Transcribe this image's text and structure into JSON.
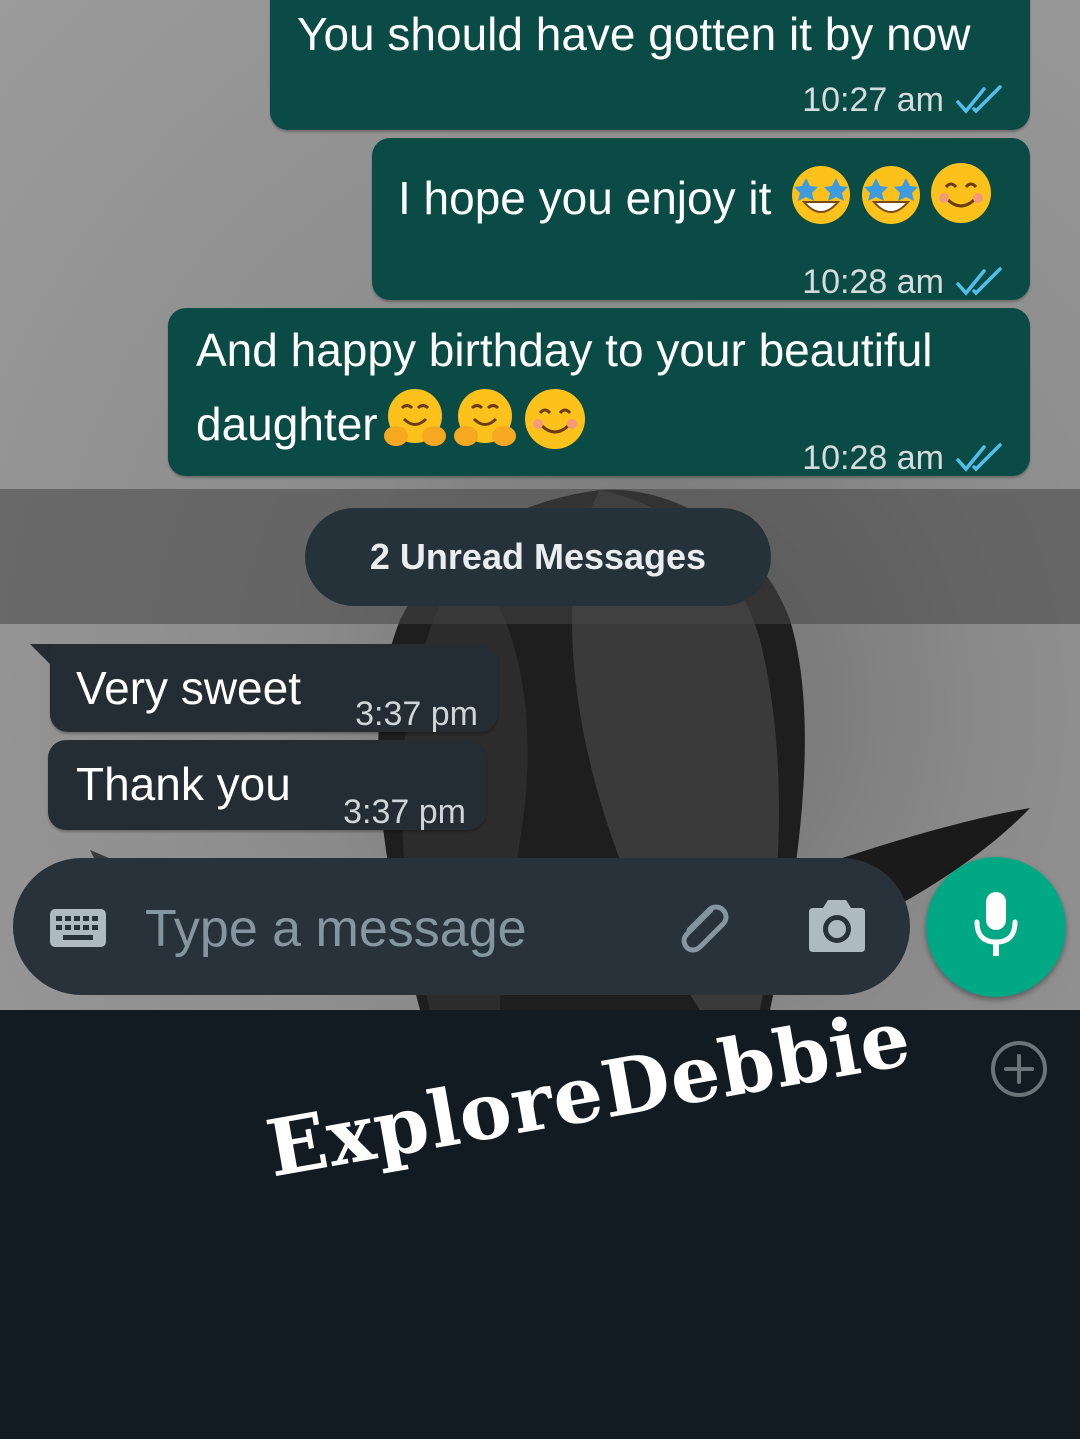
{
  "messages": [
    {
      "direction": "outgoing",
      "text": "You should have gotten it by now",
      "time": "10:27 am",
      "status": "read"
    },
    {
      "direction": "outgoing",
      "text": "I hope you enjoy it",
      "emojis": [
        "star-struck",
        "star-struck",
        "smiling-face"
      ],
      "time": "10:28 am",
      "status": "read"
    },
    {
      "direction": "outgoing",
      "text_line1": "And happy birthday to your beautiful",
      "text_line2": "daughter",
      "emojis": [
        "hugging-face",
        "hugging-face",
        "smiling-face"
      ],
      "time": "10:28 am",
      "status": "read"
    },
    {
      "direction": "incoming",
      "text": "Very sweet",
      "time": "3:37 pm"
    },
    {
      "direction": "incoming",
      "text": "Thank you",
      "time": "3:37 pm"
    }
  ],
  "unread_banner": "2 Unread Messages",
  "composer": {
    "placeholder": "Type a message",
    "value": "",
    "icons": [
      "keyboard-icon",
      "paperclip-icon",
      "camera-icon"
    ]
  },
  "mic_icon": "microphone-icon",
  "watermark": "ExploreDebbie",
  "colors": {
    "outgoing_bubble": "#0b4b46",
    "incoming_bubble": "#232d33",
    "read_tick": "#53bdeb",
    "mic_button": "#00a884",
    "panel_background": "#111b21"
  }
}
